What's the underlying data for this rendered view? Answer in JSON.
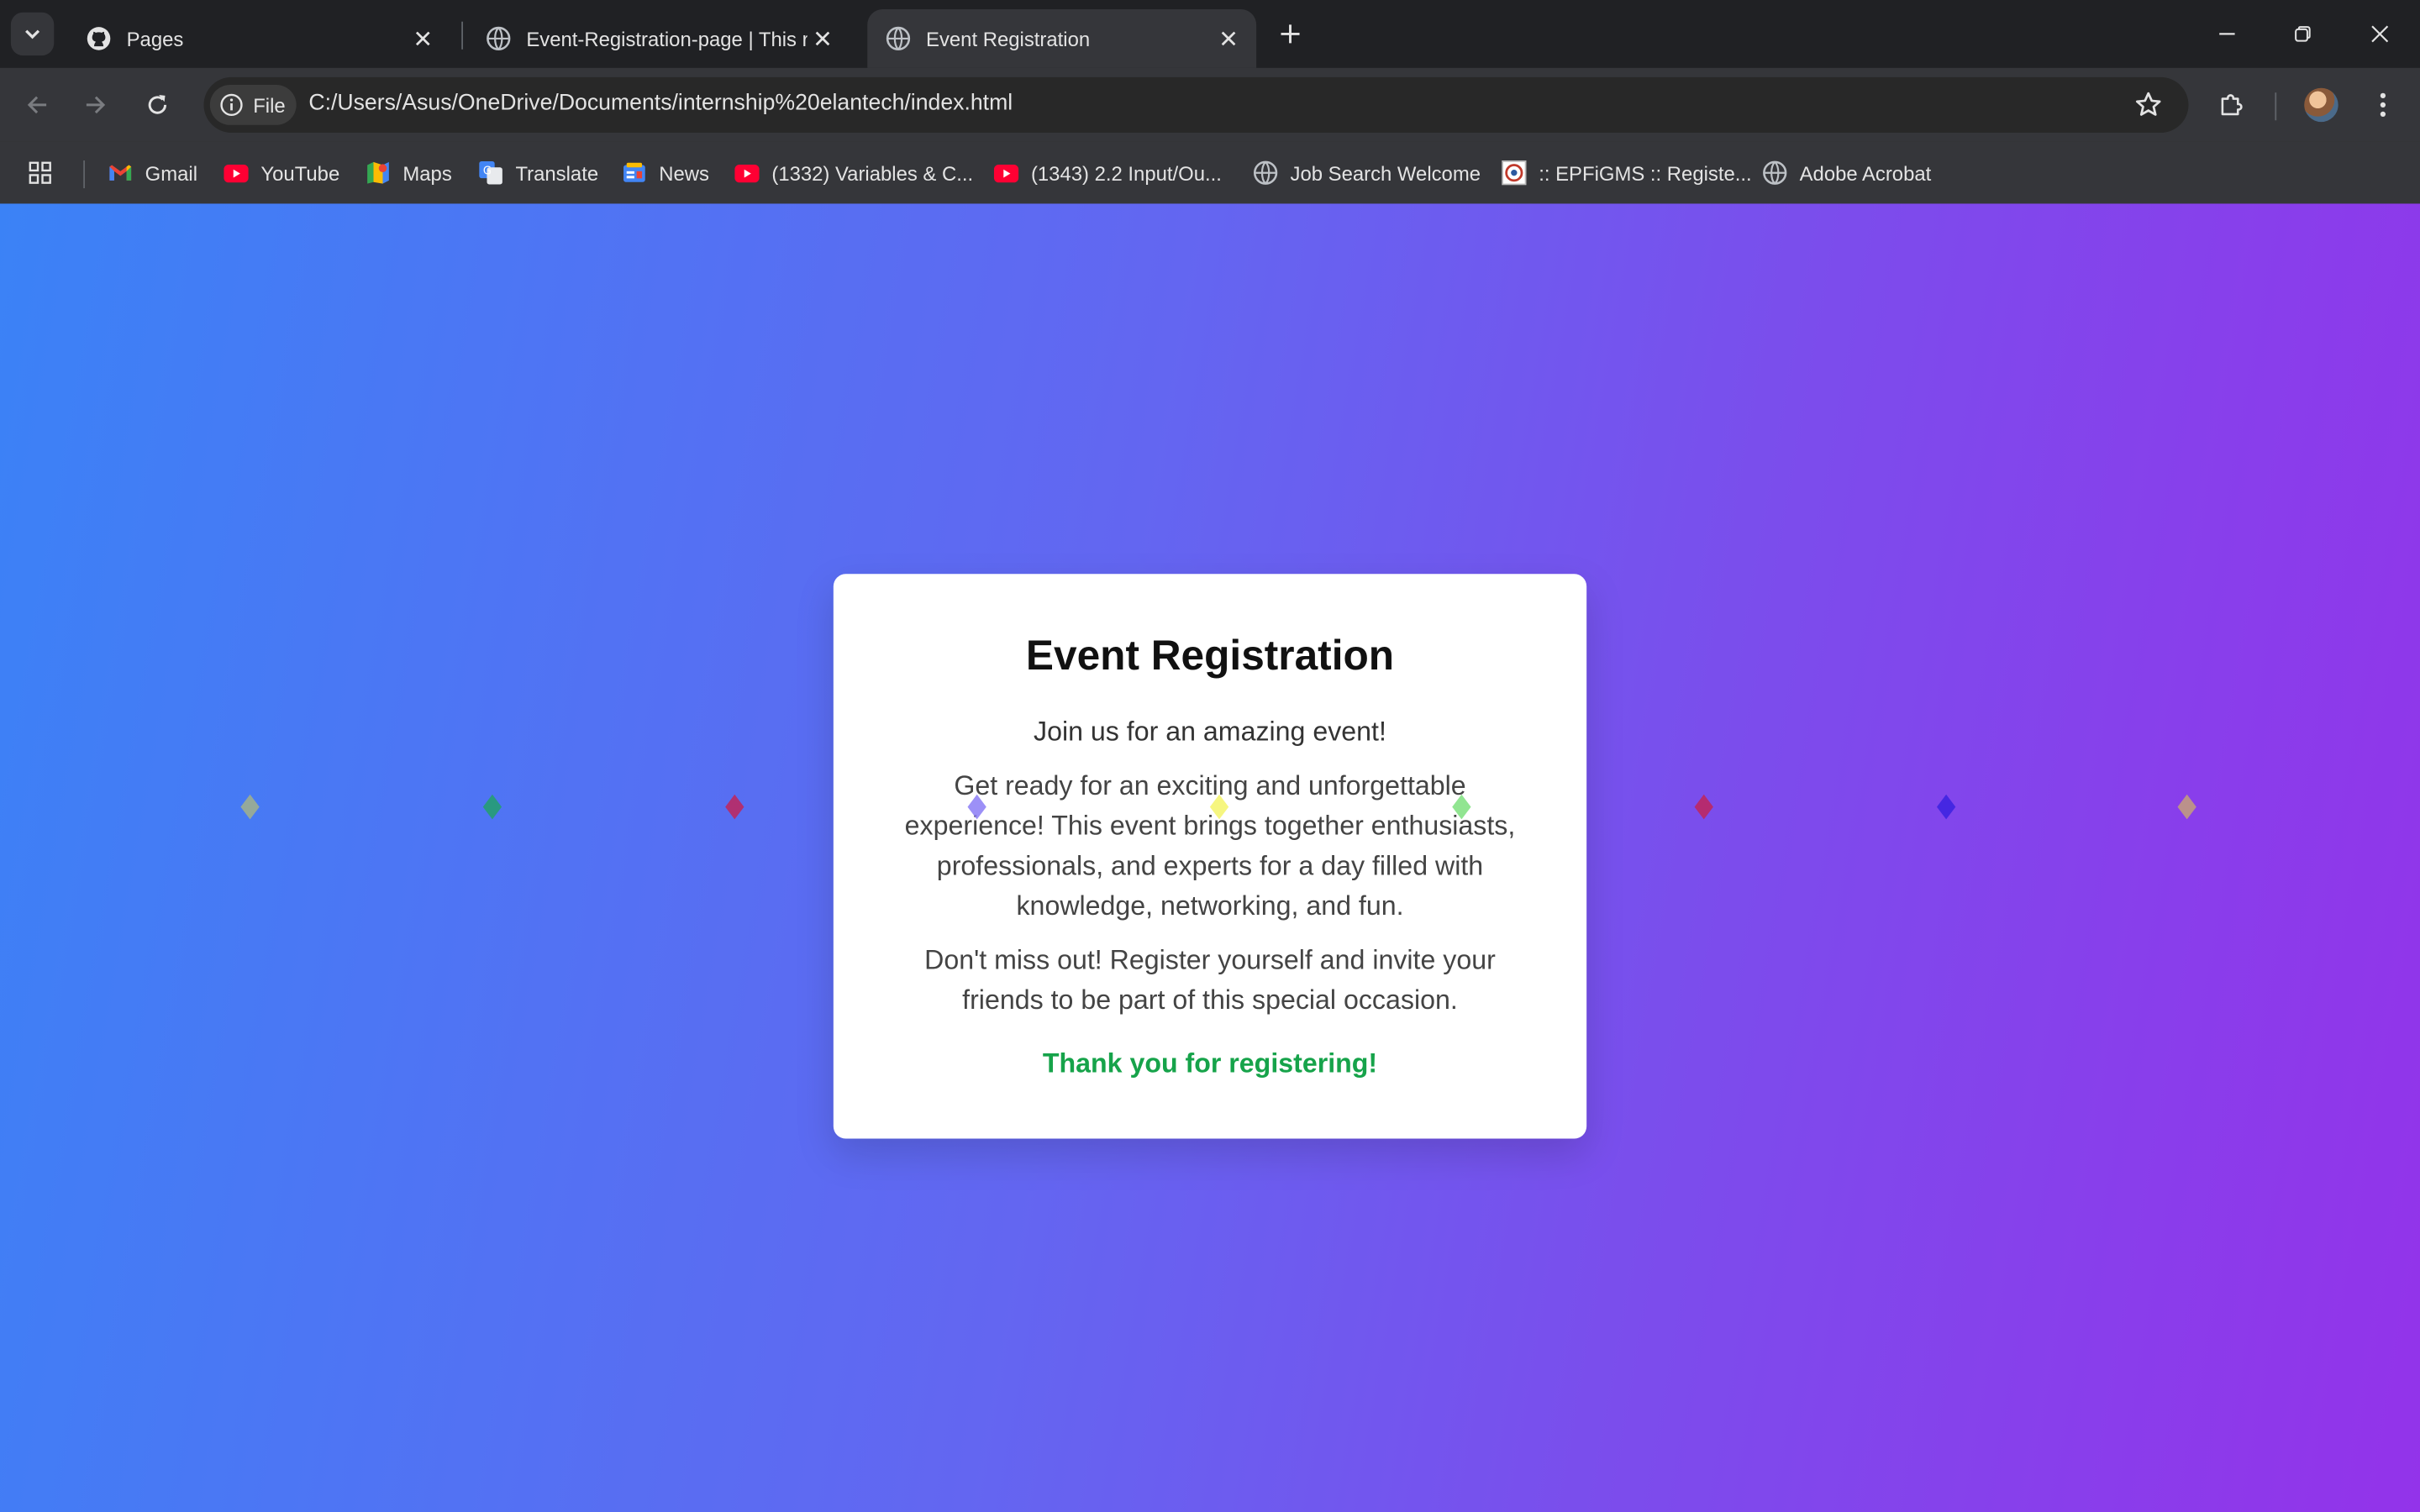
{
  "browser": {
    "tabs": [
      {
        "title": "Pages",
        "icon": "github-icon"
      },
      {
        "title": "Event-Registration-page | This r",
        "icon": "globe-icon"
      },
      {
        "title": "Event Registration",
        "icon": "globe-icon",
        "active": true
      }
    ],
    "address": {
      "chip_label": "File",
      "url": "C:/Users/Asus/OneDrive/Documents/internship%20elantech/index.html"
    },
    "bookmarks": [
      {
        "label": "Gmail",
        "icon": "gmail-icon"
      },
      {
        "label": "YouTube",
        "icon": "youtube-icon"
      },
      {
        "label": "Maps",
        "icon": "maps-icon"
      },
      {
        "label": "Translate",
        "icon": "translate-icon"
      },
      {
        "label": "News",
        "icon": "news-icon"
      },
      {
        "label": "(1332) Variables & C...",
        "icon": "youtube-icon"
      },
      {
        "label": "(1343) 2.2 Input/Ou...",
        "icon": "youtube-icon"
      },
      {
        "label": "Job Search Welcome",
        "icon": "globe-icon"
      },
      {
        "label": ":: EPFiGMS :: Registe...",
        "icon": "epfigms-icon"
      },
      {
        "label": "Adobe Acrobat",
        "icon": "globe-icon"
      }
    ]
  },
  "page": {
    "heading": "Event Registration",
    "intro": "Join us for an amazing event!",
    "description": "Get ready for an exciting and unforgettable experience! This event brings together enthusiasts, professionals, and experts for a day filled with knowledge, networking, and fun.",
    "invite": "Don't miss out! Register yourself and invite your friends to be part of this special occasion.",
    "thanks": "Thank you for registering!",
    "colors": {
      "gradient_start": "#3b82f6",
      "gradient_end": "#9333ea",
      "thanks_color": "#16a34a"
    },
    "confetti_colors": [
      "#a3b18a",
      "#22a06b",
      "#c0265a",
      "#8b7cf6",
      "#f5f56a",
      "#7ee07e",
      "#c0265a",
      "#3b22e0",
      "#c4a07a"
    ]
  }
}
